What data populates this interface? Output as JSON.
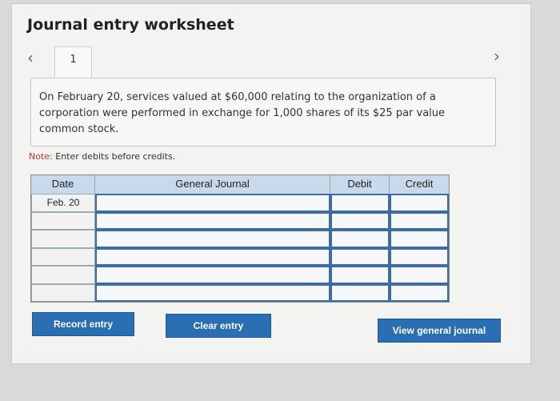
{
  "page": {
    "title": "Journal entry worksheet"
  },
  "tabs": [
    {
      "label": "1"
    }
  ],
  "question": {
    "text": "On February 20, services valued at $60,000 relating to the organization of a corporation were performed in exchange for 1,000 shares of its $25 par value common stock."
  },
  "note": {
    "label": "Note:",
    "text": "Enter debits before credits."
  },
  "table": {
    "headers": {
      "date": "Date",
      "journal": "General Journal",
      "debit": "Debit",
      "credit": "Credit"
    },
    "rows": [
      {
        "date": "Feb. 20",
        "journal": "",
        "debit": "",
        "credit": ""
      },
      {
        "date": "",
        "journal": "",
        "debit": "",
        "credit": ""
      },
      {
        "date": "",
        "journal": "",
        "debit": "",
        "credit": ""
      },
      {
        "date": "",
        "journal": "",
        "debit": "",
        "credit": ""
      },
      {
        "date": "",
        "journal": "",
        "debit": "",
        "credit": ""
      },
      {
        "date": "",
        "journal": "",
        "debit": "",
        "credit": ""
      }
    ]
  },
  "buttons": {
    "record": "Record entry",
    "clear": "Clear entry",
    "view": "View general journal"
  },
  "nav": {
    "prev_icon": "chevron-left-icon",
    "next_icon": "chevron-right-icon"
  },
  "colors": {
    "button": "#2a6fb3",
    "header": "#c9d9ec",
    "journal_border": "#3f6da3"
  }
}
